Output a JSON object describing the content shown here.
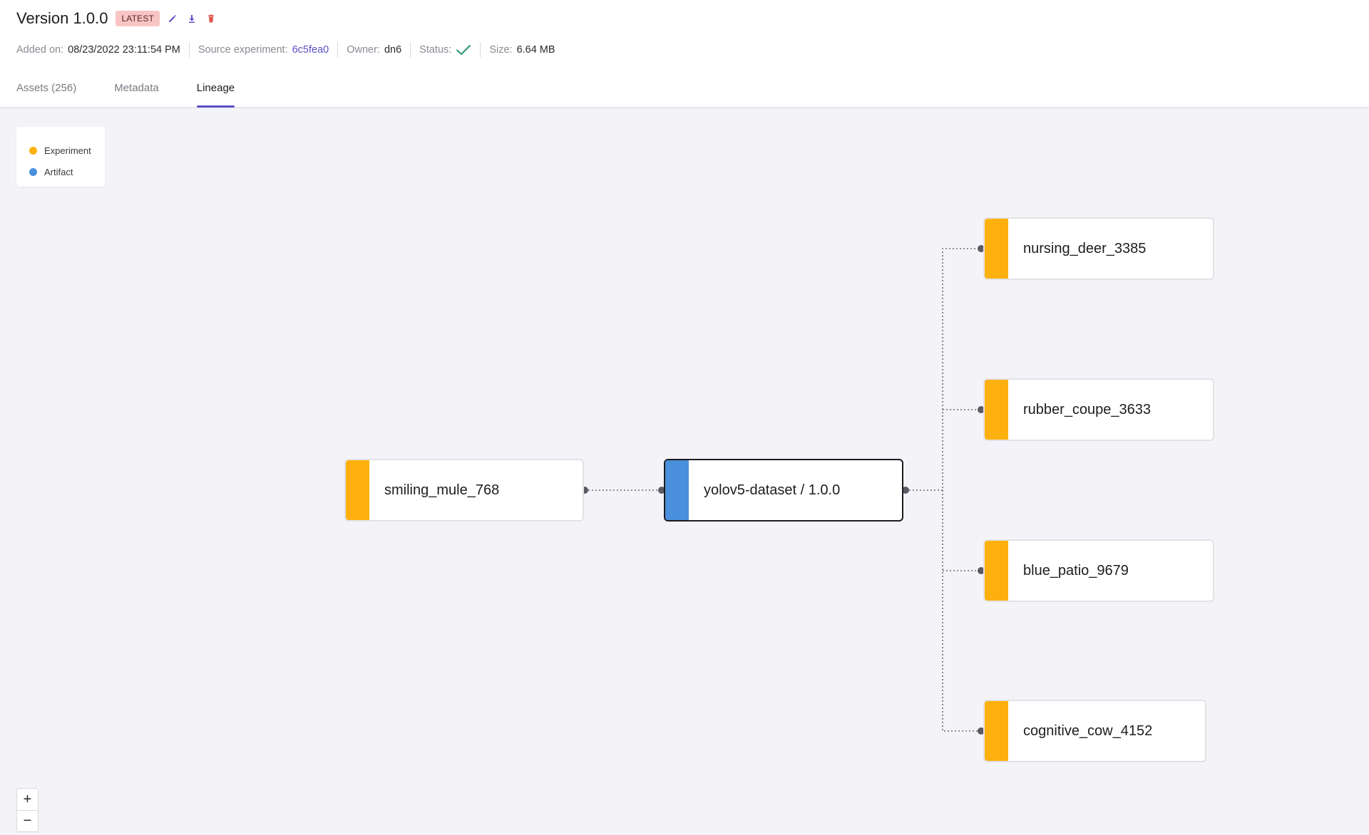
{
  "header": {
    "title": "Version 1.0.0",
    "badge": "LATEST",
    "actions": [
      {
        "icon": "pencil-icon",
        "color": "#5b4fc6"
      },
      {
        "icon": "download-icon",
        "color": "#5b4fc6"
      },
      {
        "icon": "trash-icon",
        "color": "#e2554f"
      }
    ]
  },
  "meta": {
    "added_label": "Added on:",
    "added_value": "08/23/2022 23:11:54 PM",
    "source_label": "Source experiment:",
    "source_value": "6c5fea0",
    "owner_label": "Owner:",
    "owner_value": "dn6",
    "status_label": "Status:",
    "status_icon": "check-icon",
    "size_label": "Size:",
    "size_value": "6.64 MB"
  },
  "tabs": [
    {
      "label": "Assets (256)",
      "active": false
    },
    {
      "label": "Metadata",
      "active": false
    },
    {
      "label": "Lineage",
      "active": true
    }
  ],
  "legend": [
    {
      "label": "Experiment",
      "color": "#fdb00e"
    },
    {
      "label": "Artifact",
      "color": "#4a90dc"
    }
  ],
  "graph": {
    "nodes": [
      {
        "label": "smiling_mule_768",
        "type": "Experiment"
      },
      {
        "label": "yolov5-dataset / 1.0.0",
        "type": "Artifact",
        "selected": true
      },
      {
        "label": "nursing_deer_3385",
        "type": "Experiment"
      },
      {
        "label": "rubber_coupe_3633",
        "type": "Experiment"
      },
      {
        "label": "blue_patio_9679",
        "type": "Experiment"
      },
      {
        "label": "cognitive_cow_4152",
        "type": "Experiment"
      }
    ]
  },
  "zoom": {
    "in_label": "+",
    "out_label": "−"
  }
}
